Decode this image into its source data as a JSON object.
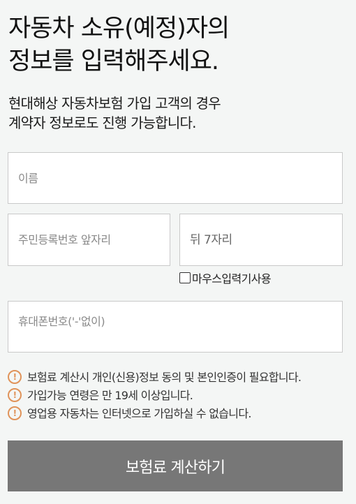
{
  "title": {
    "line1": "자동차 소유(예정)자의",
    "line2": "정보를 입력해주세요."
  },
  "subtitle": {
    "line1": "현대해상 자동차보험 가입 고객의 경우",
    "line2": "계약자 정보로도 진행 가능합니다."
  },
  "form": {
    "name_placeholder": "이름",
    "name_value": "",
    "rrn_front_placeholder": "주민등록번호 앞자리",
    "rrn_front_value": "",
    "rrn_back_placeholder": "뒤 7자리",
    "rrn_back_value": "",
    "mouse_input_label": "마우스입력기사용",
    "mouse_input_checked": false,
    "phone_placeholder": "휴대폰번호('-'없이)",
    "phone_value": ""
  },
  "notices": [
    "보험료 계산시 개인(신용)정보 동의 및 본인인증이 필요합니다.",
    "가입가능 연령은 만 19세 이상입니다.",
    "영업용 자동차는 인터넷으로 가입하실 수 없습니다."
  ],
  "notice_icon": "exclamation-circle-icon",
  "submit_label": "보험료 계산하기",
  "colors": {
    "background": "#f4f6f5",
    "button": "#777777",
    "warning": "#e0935a",
    "border": "#c9c9c9"
  }
}
